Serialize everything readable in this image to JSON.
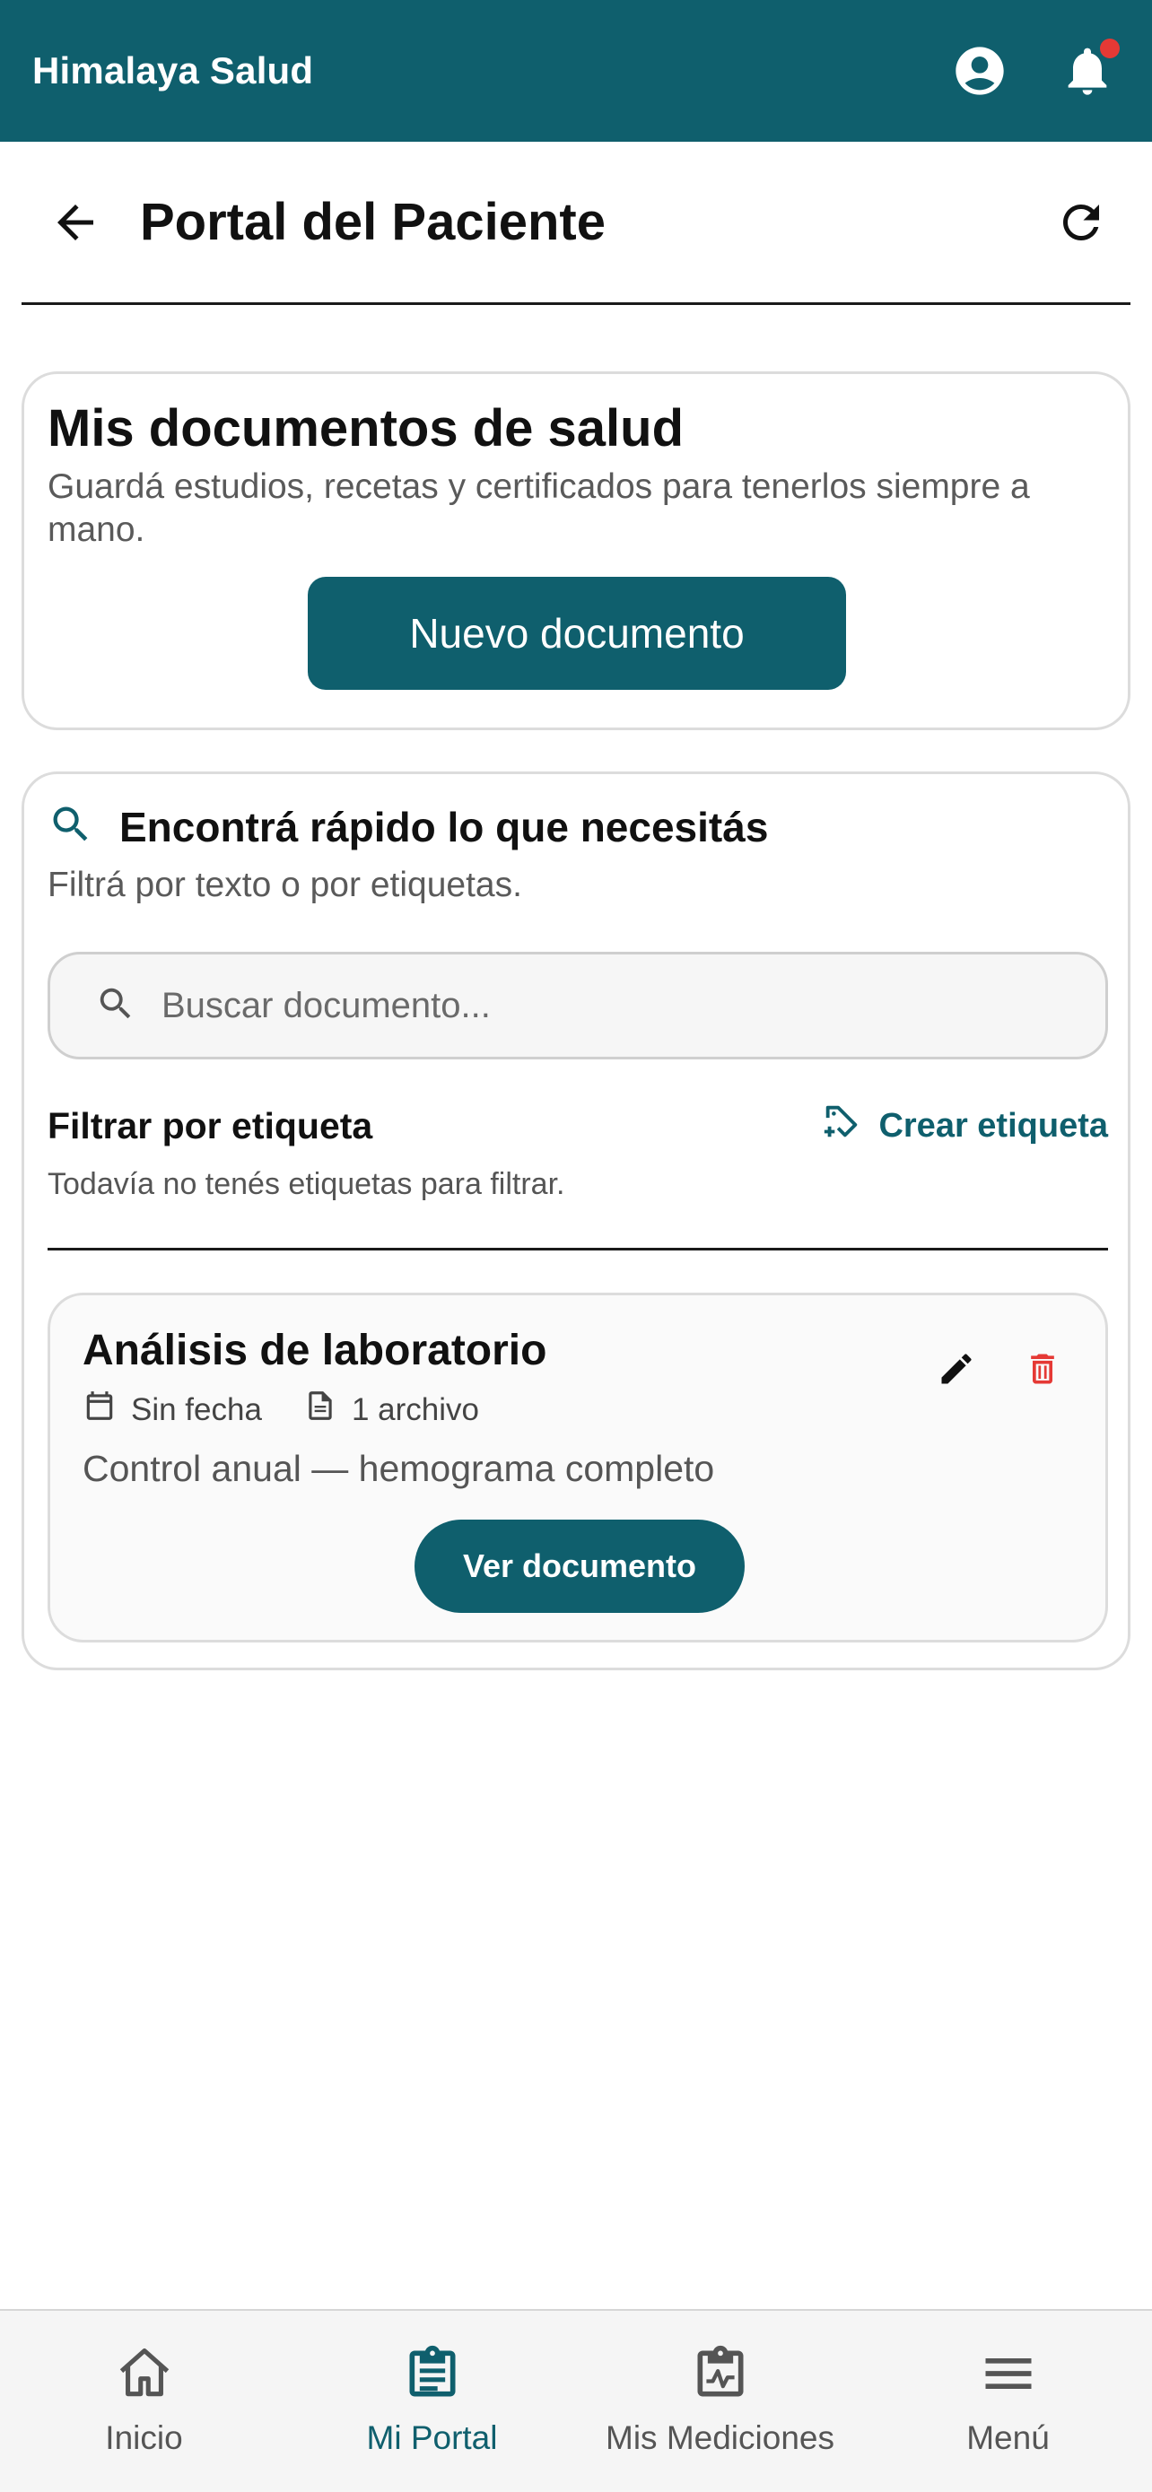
{
  "app": {
    "brand": "Himalaya Salud"
  },
  "header": {
    "title": "Portal del Paciente"
  },
  "documents_card": {
    "title": "Mis documentos de salud",
    "subtitle": "Guardá estudios, recetas y certificados para tenerlos siempre a mano.",
    "new_button": "Nuevo documento"
  },
  "filter_card": {
    "title": "Encontrá rápido lo que necesitás",
    "subtitle": "Filtrá por texto o por etiquetas.",
    "search_placeholder": "Buscar documento...",
    "filter_label": "Filtrar por etiqueta",
    "create_tag": "Crear etiqueta",
    "empty_tags": "Todavía no tenés etiquetas para filtrar."
  },
  "documents": [
    {
      "title": "Análisis de laboratorio",
      "date": "Sin fecha",
      "files": "1 archivo",
      "description": "Control anual — hemograma completo",
      "view_button": "Ver documento"
    }
  ],
  "bottom_nav": [
    {
      "label": "Inicio",
      "icon": "home-icon",
      "active": false
    },
    {
      "label": "Mi Portal",
      "icon": "clipboard-icon",
      "active": true
    },
    {
      "label": "Mis Mediciones",
      "icon": "chart-clipboard-icon",
      "active": false
    },
    {
      "label": "Menú",
      "icon": "menu-icon",
      "active": false
    }
  ],
  "colors": {
    "primary": "#0f5f6d",
    "danger": "#e53935",
    "notification": "#e53935"
  }
}
